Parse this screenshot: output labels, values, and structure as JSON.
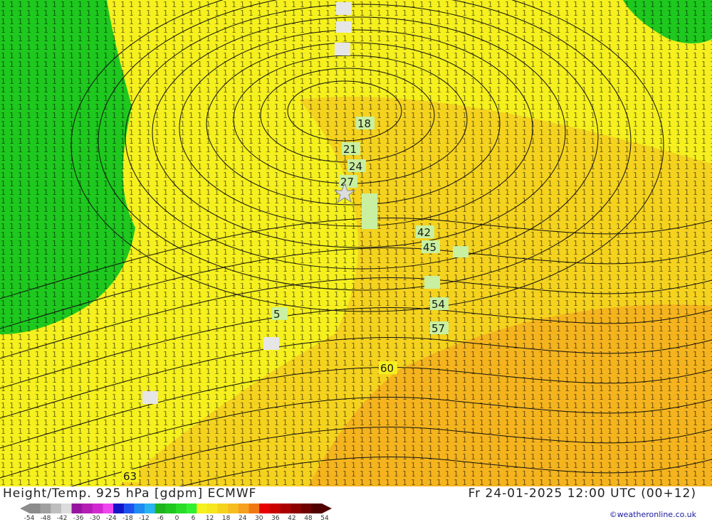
{
  "map": {
    "colors": {
      "green": "#1ec81e",
      "yellow": "#f5f01e",
      "deep_yellow": "#f5d21e",
      "orange": "#f5b41e",
      "contour": "#111111",
      "label_box": "#c8f0a0",
      "station_box": "#e6e6e6"
    },
    "contour_labels": [
      "18",
      "21",
      "24",
      "27",
      "42",
      "45",
      "54",
      "57",
      "60",
      "63",
      "5"
    ]
  },
  "footer": {
    "title_left": "Height/Temp. 925 hPa [gdpm] ECMWF",
    "title_right": "Fr 24-01-2025 12:00 UTC (00+12)",
    "credit": "©weatheronline.co.uk"
  },
  "legend": {
    "ticks": [
      "-54",
      "-48",
      "-42",
      "-36",
      "-30",
      "-24",
      "-18",
      "-12",
      "-6",
      "0",
      "6",
      "12",
      "18",
      "24",
      "30",
      "36",
      "42",
      "48",
      "54"
    ],
    "colors": [
      "#8c8c8c",
      "#a0a0a0",
      "#bebebe",
      "#dcdcdc",
      "#9614a0",
      "#b41eb4",
      "#d228d2",
      "#f046f0",
      "#1414c8",
      "#1e50f0",
      "#1e8cf0",
      "#28b4f0",
      "#1eb41e",
      "#1ec81e",
      "#28dc28",
      "#32f032",
      "#f5f01e",
      "#f5e61e",
      "#f5d21e",
      "#f5be1e",
      "#f5a01e",
      "#f07814",
      "#e60000",
      "#c80000",
      "#aa0000",
      "#8c0000",
      "#6e0000",
      "#500000"
    ]
  }
}
